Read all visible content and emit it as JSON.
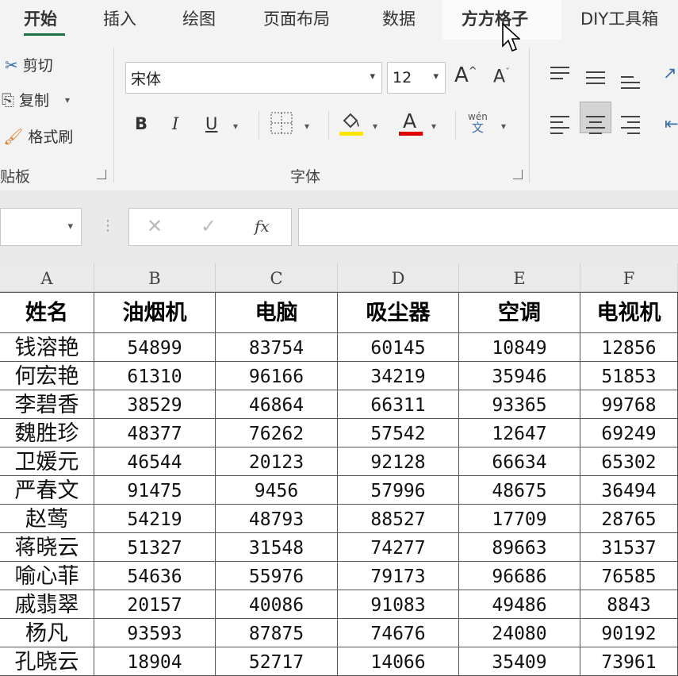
{
  "ribbon_tabs": [
    {
      "label": "开始",
      "active": true
    },
    {
      "label": "插入",
      "active": false
    },
    {
      "label": "绘图",
      "active": false
    },
    {
      "label": "页面布局",
      "active": false
    },
    {
      "label": "数据",
      "active": false
    },
    {
      "label": "方方格子",
      "active": false,
      "hover": true
    },
    {
      "label": "DIY工具箱",
      "active": false
    }
  ],
  "clipboard": {
    "cut_label": "剪切",
    "copy_label": "复制",
    "format_painter_label": "格式刷",
    "group_label": "贴板"
  },
  "font": {
    "name_value": "宋体",
    "size_value": "12",
    "grow_glyph": "A",
    "shrink_glyph": "A",
    "bold_glyph": "B",
    "italic_glyph": "I",
    "underline_glyph": "U",
    "font_color_glyph": "A",
    "phonetic_top": "wén",
    "phonetic_bottom": "文",
    "group_label": "字体",
    "fill_color": "#ffe600",
    "font_color": "#e00000"
  },
  "formula_bar": {
    "fx_label": "fx",
    "cancel_glyph": "✕",
    "enter_glyph": "✓"
  },
  "sheet": {
    "column_headers": [
      "A",
      "B",
      "C",
      "D",
      "E",
      "F"
    ],
    "header_row": [
      "姓名",
      "油烟机",
      "电脑",
      "吸尘器",
      "空调",
      "电视机"
    ],
    "rows": [
      [
        "钱溶艳",
        "54899",
        "83754",
        "60145",
        "10849",
        "12856"
      ],
      [
        "何宏艳",
        "61310",
        "96166",
        "34219",
        "35946",
        "51853"
      ],
      [
        "李碧香",
        "38529",
        "46864",
        "66311",
        "93365",
        "99768"
      ],
      [
        "魏胜珍",
        "48377",
        "76262",
        "57542",
        "12647",
        "69249"
      ],
      [
        "卫媛元",
        "46544",
        "20123",
        "92128",
        "66634",
        "65302"
      ],
      [
        "严春文",
        "91475",
        "9456",
        "57996",
        "48675",
        "36494"
      ],
      [
        "赵莺",
        "54219",
        "48793",
        "88527",
        "17709",
        "28765"
      ],
      [
        "蒋晓云",
        "51327",
        "31548",
        "74277",
        "89663",
        "31537"
      ],
      [
        "喻心菲",
        "54636",
        "55976",
        "79173",
        "96686",
        "76585"
      ],
      [
        "戚翡翠",
        "20157",
        "40086",
        "91083",
        "49486",
        "8843"
      ],
      [
        "杨凡",
        "93593",
        "87875",
        "74676",
        "24080",
        "90192"
      ],
      [
        "孔晓云",
        "18904",
        "52717",
        "14066",
        "35409",
        "73961"
      ]
    ]
  }
}
